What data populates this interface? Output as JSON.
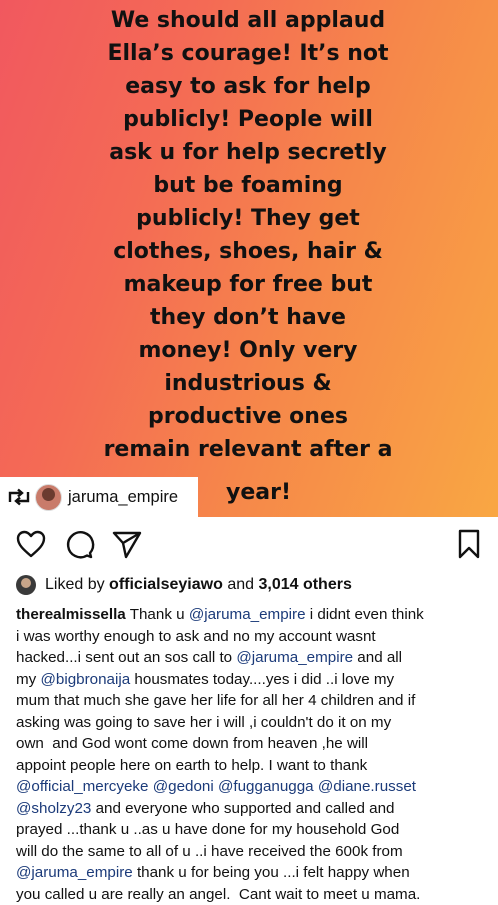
{
  "post": {
    "quote_lines": [
      "We should all applaud",
      "Ella’s courage! It’s not",
      "easy to ask for help",
      "publicly! People will",
      "ask u for help secretly",
      "but be foaming",
      "publicly! They get",
      "clothes, shoes, hair &",
      "makeup for free but",
      "they don’t have",
      "money! Only very",
      "industrious &",
      "productive ones",
      "remain relevant after a"
    ],
    "quote_last_line": "year!",
    "repost_tag": {
      "icon": "repost-icon",
      "username": "jaruma_empire"
    },
    "gradient_colors": [
      "#f1585f",
      "#f9a743"
    ]
  },
  "actions": {
    "like_icon": "heart-icon",
    "comment_icon": "comment-icon",
    "share_icon": "send-icon",
    "save_icon": "bookmark-icon"
  },
  "likes": {
    "prefix": "Liked by ",
    "user": "officialseyiawo",
    "middle": " and ",
    "count": "3,014 others"
  },
  "caption": {
    "lines": [
      [
        {
          "t": "therealmissella",
          "k": "user"
        },
        {
          "t": " Thank u ",
          "k": "text"
        },
        {
          "t": "@jaruma_empire",
          "k": "mention"
        },
        {
          "t": " i didnt even think",
          "k": "text"
        }
      ],
      [
        {
          "t": "i was worthy enough to ask and no my account wasnt",
          "k": "text"
        }
      ],
      [
        {
          "t": "hacked...i sent out an sos call to ",
          "k": "text"
        },
        {
          "t": "@jaruma_empire",
          "k": "mention"
        },
        {
          "t": " and all",
          "k": "text"
        }
      ],
      [
        {
          "t": "my ",
          "k": "text"
        },
        {
          "t": "@bigbronaija",
          "k": "mention"
        },
        {
          "t": " housmates today....yes i did ..i love my",
          "k": "text"
        }
      ],
      [
        {
          "t": "mum that much she gave her life for all her 4 children and if",
          "k": "text"
        }
      ],
      [
        {
          "t": "asking was going to save her i will ,i couldn't do it on my",
          "k": "text"
        }
      ],
      [
        {
          "t": "own  and God wont come down from heaven ,he will",
          "k": "text"
        }
      ],
      [
        {
          "t": "appoint people here on earth to help. I want to thank",
          "k": "text"
        }
      ],
      [
        {
          "t": "@official_mercyeke",
          "k": "mention"
        },
        {
          "t": " ",
          "k": "text"
        },
        {
          "t": "@gedoni",
          "k": "mention"
        },
        {
          "t": " ",
          "k": "text"
        },
        {
          "t": "@fugganugga",
          "k": "mention"
        },
        {
          "t": " ",
          "k": "text"
        },
        {
          "t": "@diane.russet",
          "k": "mention"
        }
      ],
      [
        {
          "t": "@sholzy23",
          "k": "mention"
        },
        {
          "t": " and everyone who supported and called and",
          "k": "text"
        }
      ],
      [
        {
          "t": "prayed ...thank u ..as u have done for my household God",
          "k": "text"
        }
      ],
      [
        {
          "t": "will do the same to all of u ..i have received the 600k from",
          "k": "text"
        }
      ],
      [
        {
          "t": "@jaruma_empire",
          "k": "mention"
        },
        {
          "t": " thank u for being you ...i felt happy when",
          "k": "text"
        }
      ],
      [
        {
          "t": "you called u are really an angel.  Cant wait to meet u mama.",
          "k": "text"
        }
      ]
    ]
  }
}
